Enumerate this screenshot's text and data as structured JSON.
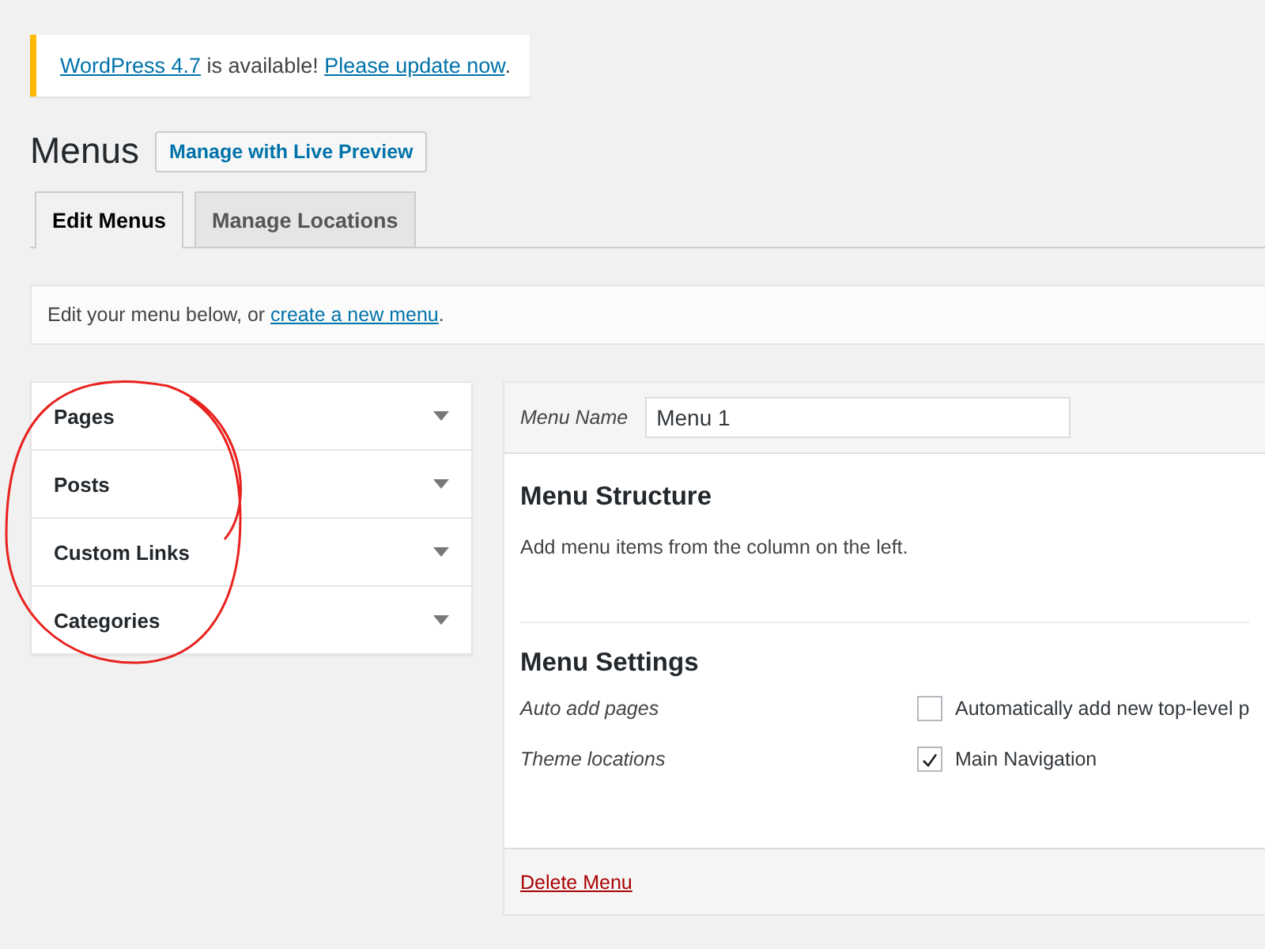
{
  "notice": {
    "parts": [
      {
        "kind": "link",
        "text": "WordPress 4.7"
      },
      {
        "kind": "text",
        "text": " is available! "
      },
      {
        "kind": "link",
        "text": "Please update now"
      },
      {
        "kind": "text",
        "text": "."
      }
    ]
  },
  "page_title": "Menus",
  "header_button": "Manage with Live Preview",
  "tabs": [
    {
      "label": "Edit Menus",
      "selected": true
    },
    {
      "label": "Manage Locations",
      "selected": false
    }
  ],
  "manage_box": {
    "parts": [
      {
        "kind": "text",
        "text": "Edit your menu below, or "
      },
      {
        "kind": "link",
        "text": "create a new menu"
      },
      {
        "kind": "text",
        "text": "."
      }
    ]
  },
  "accordion": [
    {
      "label": "Pages"
    },
    {
      "label": "Posts"
    },
    {
      "label": "Custom Links"
    },
    {
      "label": "Categories"
    }
  ],
  "menu_editor": {
    "name_label": "Menu Name",
    "name_value": "Menu 1",
    "structure_title": "Menu Structure",
    "structure_text": "Add menu items from the column on the left.",
    "settings_title": "Menu Settings",
    "settings": [
      {
        "label": "Auto add pages",
        "option": "Automatically add new top-level p",
        "checked": false
      },
      {
        "label": "Theme locations",
        "option": "Main Navigation",
        "checked": true
      }
    ],
    "delete_link": "Delete Menu"
  }
}
